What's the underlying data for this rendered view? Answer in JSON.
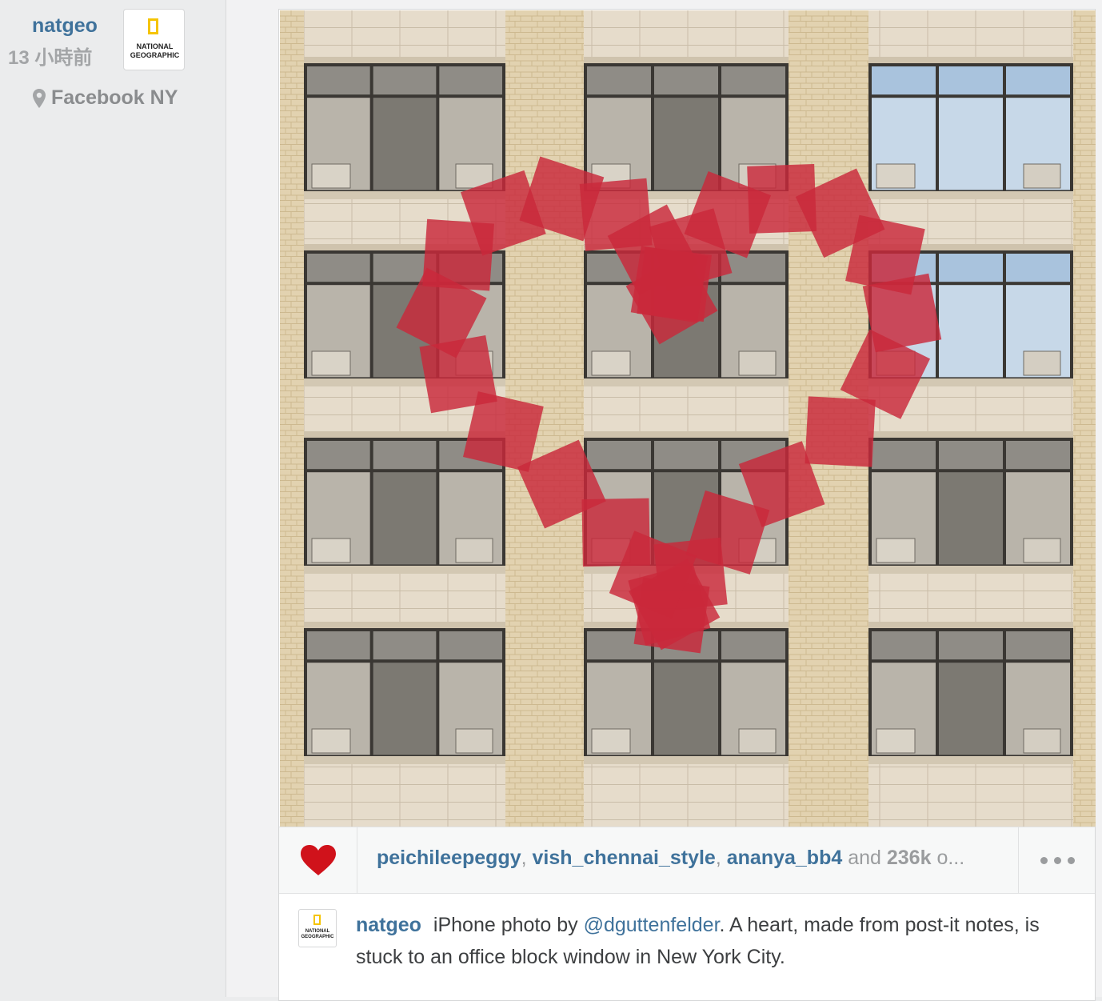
{
  "post": {
    "username": "natgeo",
    "time_ago": "13 小時前",
    "location": "Facebook NY",
    "avatar": {
      "brand_line1": "NATIONAL",
      "brand_line2": "GEOGRAPHIC",
      "icon": "national-geographic-logo"
    }
  },
  "photo": {
    "icon": "heart-post-it-photo"
  },
  "actions": {
    "like_icon": "heart-icon",
    "like_color": "#d0121b",
    "likers": [
      "peichileepeggy",
      "vish_chennai_style",
      "ananya_bb4"
    ],
    "likers_sep": ", ",
    "and_text": "and",
    "like_count": "236k",
    "others_suffix": "o...",
    "more_icon": "ellipsis-icon"
  },
  "caption": {
    "username": "natgeo",
    "text_before": "iPhone photo by ",
    "mention": "@dguttenfelder",
    "text_after": ". A heart, made from post-it notes, is stuck to an office block window in New York City."
  },
  "colors": {
    "link": "#3f729b",
    "muted": "#9a9c9e",
    "brand_yellow": "#f5c400"
  }
}
